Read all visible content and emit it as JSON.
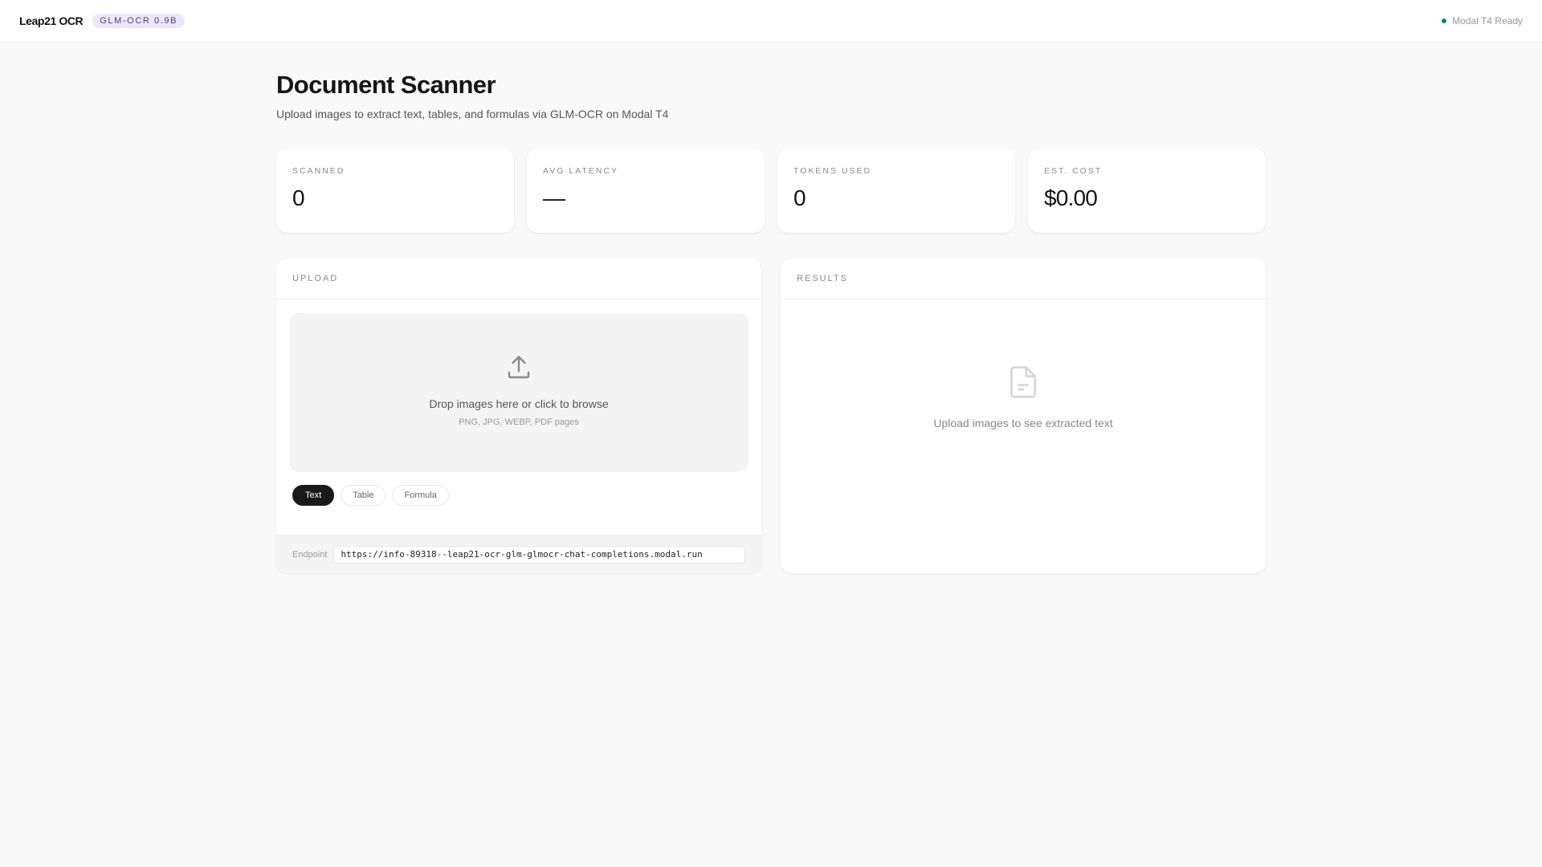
{
  "header": {
    "brand": "Leap21 OCR",
    "badge": "GLM-OCR 0.9B",
    "status": "Modal T4 Ready",
    "status_color": "#0b8a5a"
  },
  "page": {
    "title": "Document Scanner",
    "subtitle": "Upload images to extract text, tables, and formulas via GLM-OCR on Modal T4"
  },
  "stats": [
    {
      "label": "SCANNED",
      "value": "0"
    },
    {
      "label": "AVG LATENCY",
      "value": "—"
    },
    {
      "label": "TOKENS USED",
      "value": "0"
    },
    {
      "label": "EST. COST",
      "value": "$0.00"
    }
  ],
  "upload": {
    "heading": "UPLOAD",
    "drop_text": "Drop images here or click to browse",
    "drop_hint": "PNG, JPG, WEBP, PDF pages",
    "modes": [
      {
        "label": "Text",
        "active": true
      },
      {
        "label": "Table",
        "active": false
      },
      {
        "label": "Formula",
        "active": false
      }
    ],
    "endpoint_label": "Endpoint",
    "endpoint_value": "https://info-89318--leap21-ocr-glm-glmocr-chat-completions.modal.run"
  },
  "results": {
    "heading": "RESULTS",
    "empty_text": "Upload images to see extracted text"
  }
}
